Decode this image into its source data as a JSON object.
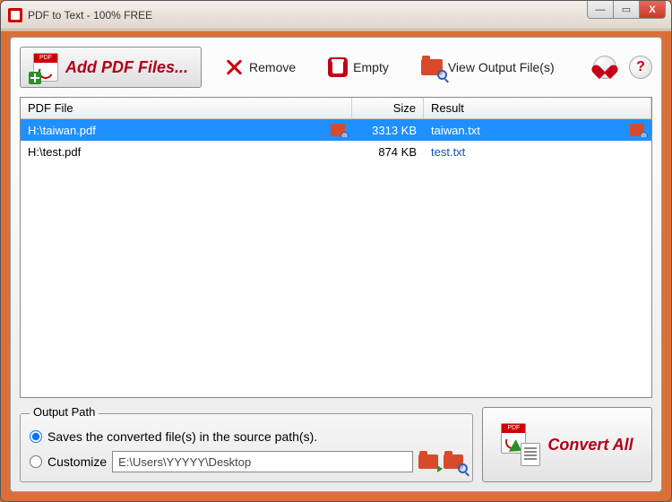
{
  "window": {
    "title": "PDF to Text - 100% FREE"
  },
  "win_controls": {
    "min": "—",
    "max": "▭",
    "close": "X"
  },
  "toolbar": {
    "add_label": "Add PDF Files...",
    "remove_label": "Remove",
    "empty_label": "Empty",
    "view_output_label": "View Output File(s)"
  },
  "circ": {
    "heart_title": "Favorite",
    "help_label": "?"
  },
  "columns": {
    "file": "PDF File",
    "size": "Size",
    "result": "Result"
  },
  "rows": [
    {
      "file": "H:\\taiwan.pdf",
      "size": "3313 KB",
      "result": "taiwan.txt",
      "selected": true
    },
    {
      "file": "H:\\test.pdf",
      "size": "874 KB",
      "result": "test.txt",
      "selected": false
    }
  ],
  "output": {
    "legend": "Output Path",
    "source_label": "Saves the converted file(s) in the source path(s).",
    "customize_label": "Customize",
    "path_value": "E:\\Users\\YYYYY\\Desktop",
    "selected": "source"
  },
  "convert": {
    "label": "Convert All"
  }
}
